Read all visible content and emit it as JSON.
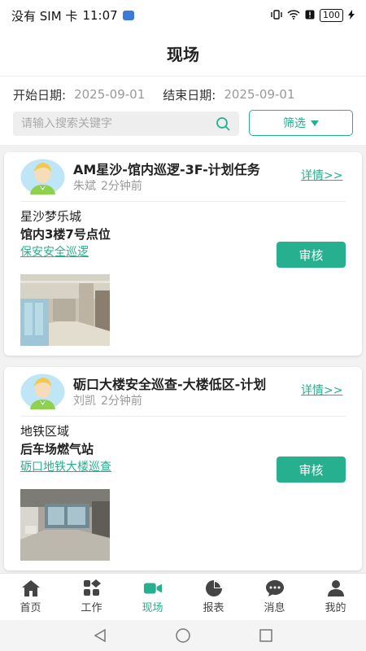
{
  "status_bar": {
    "carrier": "没有 SIM 卡",
    "time": "11:07",
    "battery": "100"
  },
  "header": {
    "title": "现场"
  },
  "filters": {
    "start_label": "开始日期:",
    "start_value": "2025-09-01",
    "end_label": "结束日期:",
    "end_value": "2025-09-01",
    "search_placeholder": "请输入搜索关键字",
    "filter_label": "筛选"
  },
  "cards": [
    {
      "title": "AM星沙-馆内巡逻-3F-计划任务",
      "user": "朱斌",
      "time_ago": "2分钟前",
      "detail_label": "详情>>",
      "area": "星沙梦乐城",
      "point": "馆内3楼7号点位",
      "route": "保安安全巡逻",
      "review_label": "审核"
    },
    {
      "title": "砺口大楼安全巡查-大楼低区-计划",
      "user": "刘凯",
      "time_ago": "2分钟前",
      "detail_label": "详情>>",
      "area": "地铁区域",
      "point": "后车场燃气站",
      "route": "砺口地铁大楼巡查",
      "review_label": "审核"
    }
  ],
  "bottom_nav": [
    {
      "label": "首页",
      "icon": "home-icon"
    },
    {
      "label": "工作",
      "icon": "grid-icon"
    },
    {
      "label": "现场",
      "icon": "video-camera-icon",
      "active": true
    },
    {
      "label": "报表",
      "icon": "pie-chart-icon"
    },
    {
      "label": "消息",
      "icon": "chat-icon"
    },
    {
      "label": "我的",
      "icon": "user-icon"
    }
  ],
  "colors": {
    "accent": "#27b08f"
  }
}
